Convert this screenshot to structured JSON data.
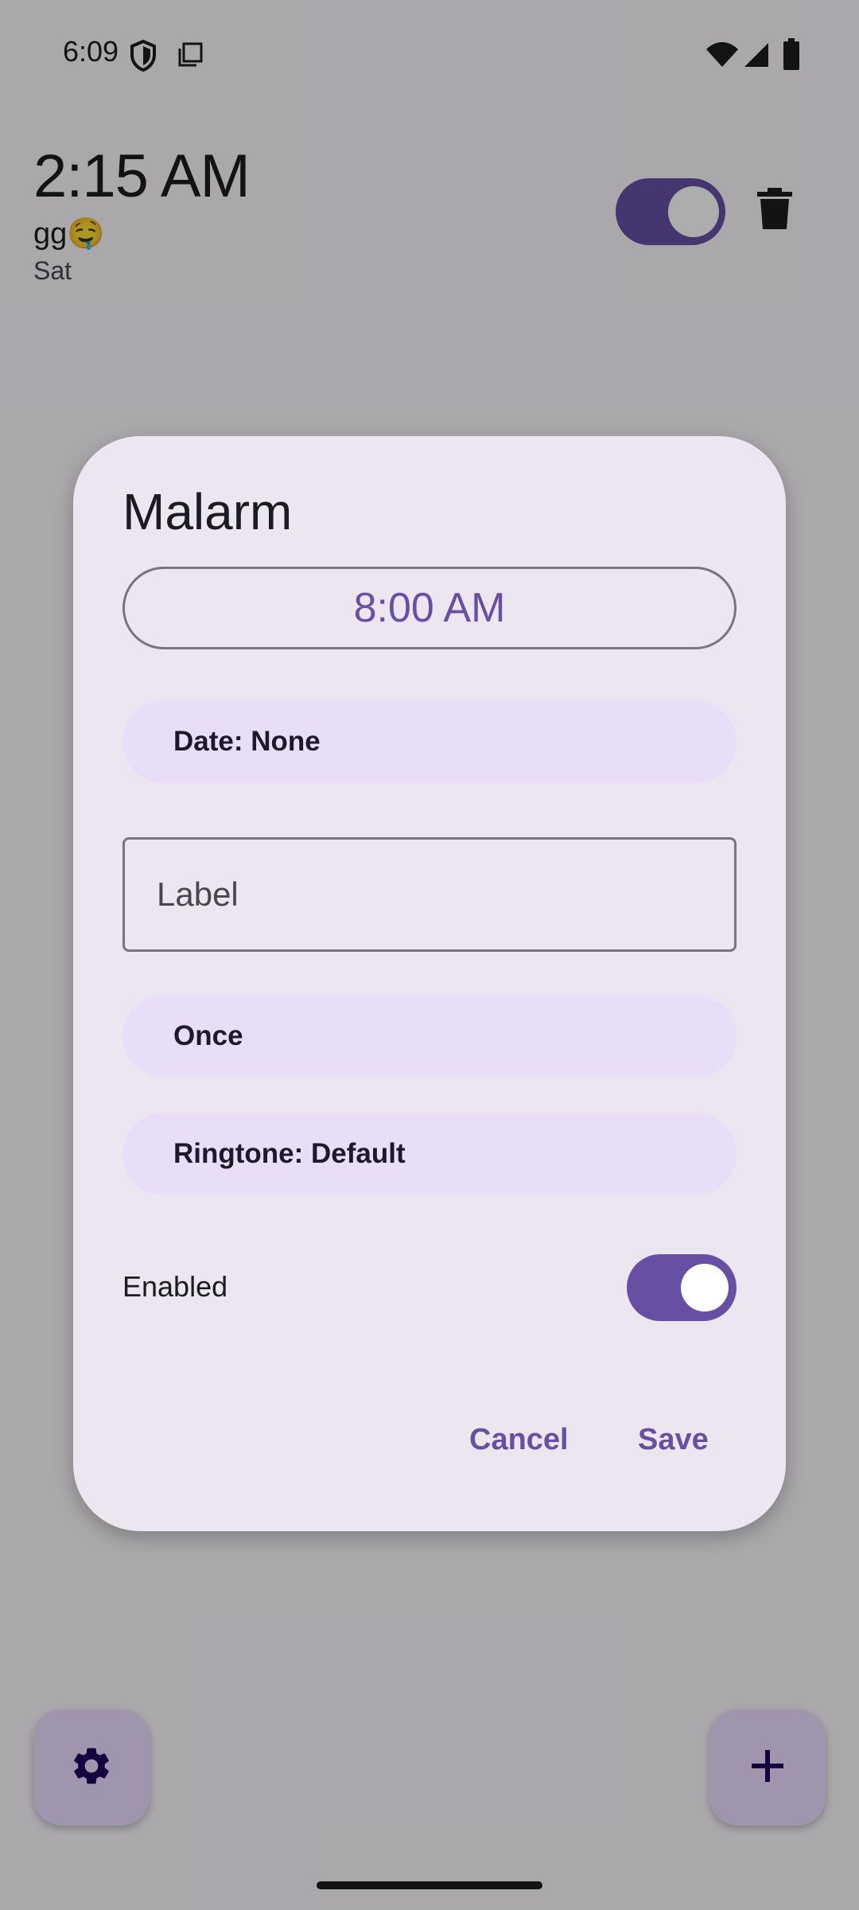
{
  "status_bar": {
    "time": "6:09"
  },
  "alarm_list": {
    "items": [
      {
        "time": "2:15 AM",
        "label": "gg🤤",
        "days": "Sat",
        "enabled": true
      }
    ]
  },
  "dialog": {
    "title": "Malarm",
    "time": "8:00 AM",
    "date_button": "Date: None",
    "label_placeholder": "Label",
    "label_value": "",
    "repeat_button": "Once",
    "ringtone_button": "Ringtone: Default",
    "enabled_text": "Enabled",
    "enabled": true,
    "cancel_label": "Cancel",
    "save_label": "Save"
  },
  "icons": {
    "settings": "gear-icon",
    "add": "plus-icon",
    "delete": "trash-icon",
    "wifi": "wifi-icon",
    "signal": "signal-icon",
    "battery": "battery-icon",
    "vpn": "shield-icon",
    "screenshot": "copy-icon"
  },
  "colors": {
    "primary": "#6750a4",
    "surface_container_high": "#ece6f0",
    "secondary_container": "#e8def8",
    "primary_container": "#eaddff",
    "outline": "#79747e"
  }
}
